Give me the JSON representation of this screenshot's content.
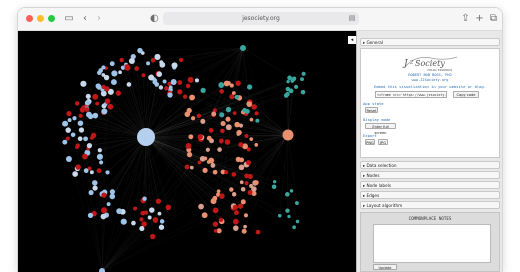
{
  "browser": {
    "url": "jesociety.org"
  },
  "panel": {
    "general_label": "General",
    "logo_text": "J2Society",
    "logo_sub": "VISUAL EDWARDS",
    "credit_line1": "ROBERT BOB BOSS, PhD",
    "credit_line2": "www.J2Society.org",
    "embed_text": "Embed this visualization in your website or blog.",
    "embed_code": "<iframe src='https://www.jesociety.org/",
    "copy_label": "Copy code",
    "app_state_label": "App state",
    "reset_label": "Reset",
    "display_mode_label": "Display mode",
    "fullscreen_label": "Enter full screen",
    "export_label": "Export",
    "png_label": "PNG",
    "jpg_label": "JPG",
    "sections": [
      "Data selection",
      "Nodes",
      "Node labels",
      "Edges",
      "Layout algorithm"
    ],
    "notes_title": "COMMONPLACE NOTES",
    "update_label": "Update"
  },
  "colors": {
    "teal": "#3aa6a0",
    "salmon": "#e89070",
    "red": "#c01818",
    "lightblue": "#9ec4ea",
    "background": "#000000"
  }
}
